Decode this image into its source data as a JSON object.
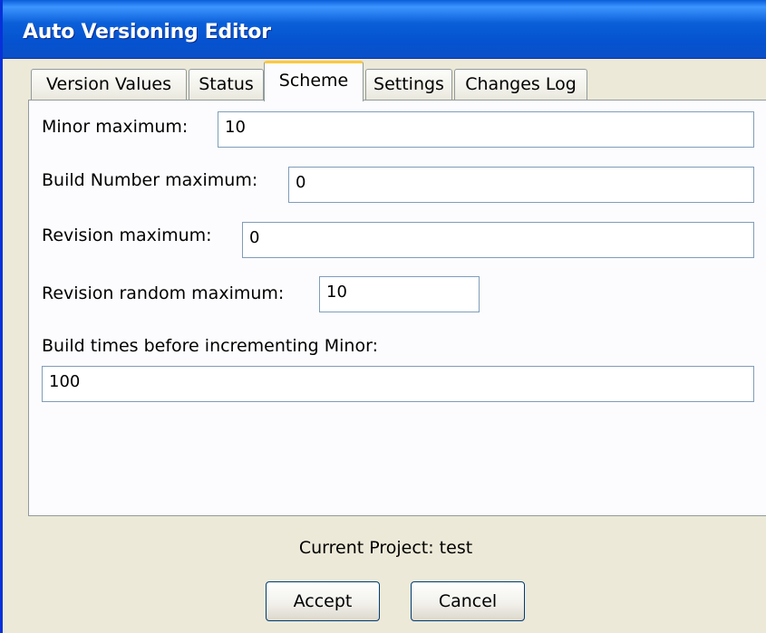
{
  "window": {
    "title": "Auto Versioning Editor"
  },
  "tabs": [
    {
      "label": "Version Values",
      "active": false
    },
    {
      "label": "Status",
      "active": false
    },
    {
      "label": "Scheme",
      "active": true
    },
    {
      "label": "Settings",
      "active": false
    },
    {
      "label": "Changes Log",
      "active": false
    }
  ],
  "scheme": {
    "minor_max_label": "Minor maximum:",
    "minor_max_value": "10",
    "build_max_label": "Build Number maximum:",
    "build_max_value": "0",
    "revision_max_label": "Revision maximum:",
    "revision_max_value": "0",
    "revision_random_label": "Revision random maximum:",
    "revision_random_value": "10",
    "build_times_label": "Build times before incrementing Minor:",
    "build_times_value": "100"
  },
  "footer": {
    "current_project": "Current Project: test",
    "accept_label": "Accept",
    "cancel_label": "Cancel"
  },
  "colors": {
    "titlebar": "#0a5fd8",
    "active_tab_accent": "#ffc83c",
    "dialog_background": "#ece9d8"
  }
}
